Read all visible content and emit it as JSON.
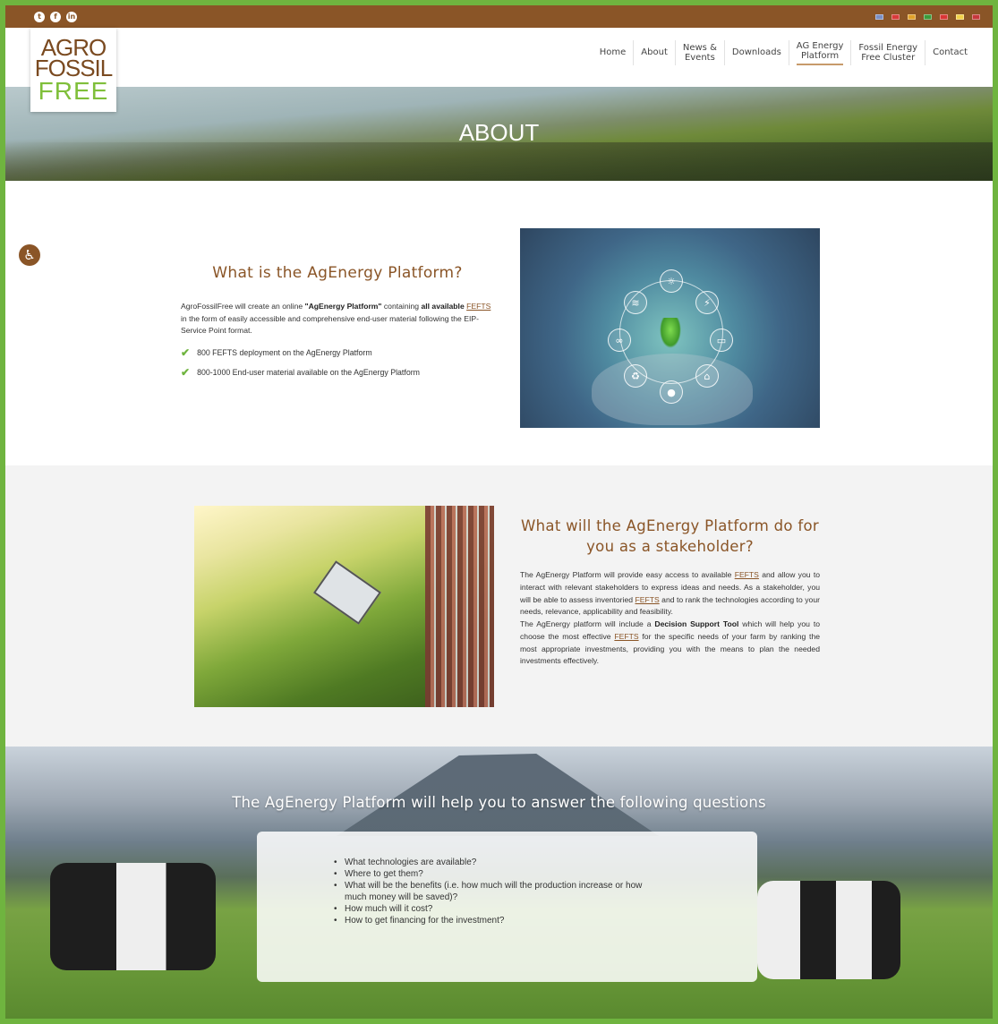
{
  "social": [
    "t",
    "f",
    "in"
  ],
  "language_flags": [
    "#7b8fc4",
    "#d83a3a",
    "#e0a12a",
    "#3b9b3b",
    "#d93535",
    "#f2d14a",
    "#c7373d"
  ],
  "logo": {
    "line1": "AGRO",
    "line2": "FOSSIL",
    "line3": "FREE"
  },
  "nav": [
    {
      "label": "Home"
    },
    {
      "label": "About"
    },
    {
      "label": "News &\nEvents"
    },
    {
      "label": "Downloads"
    },
    {
      "label": "AG Energy\nPlatform"
    },
    {
      "label": "Fossil Energy\nFree Cluster"
    },
    {
      "label": "Contact"
    }
  ],
  "hero": {
    "title": "ABOUT"
  },
  "section1": {
    "heading": "What is the AgEnergy Platform?",
    "para_pre": "AgroFossilFree will create an online ",
    "para_bold1": "\"AgEnergy Platform\"",
    "para_mid": " containing ",
    "para_bold2": "all available",
    "para_link": "FEFTS",
    "para_post": " in the form of easily accessible and comprehensive end-user material following the EIP-Service Point format.",
    "checks": [
      "800  FEFTS deployment on the AgEnergy Platform",
      "800-1000  End-user material available on the AgEnergy Platform"
    ]
  },
  "section2": {
    "heading": "What will the AgEnergy Platform do for you as a stakeholder?",
    "p1_a": "The AgEnergy Platform will provide easy access to available ",
    "p1_link1": "FEFTS",
    "p1_b": " and allow you to interact with relevant stakeholders to express ideas and needs. As a stakeholder, you will be able to assess inventoried ",
    "p1_link2": "FEFTS",
    "p1_c": " and to rank the technologies according to your needs, relevance, applicability and feasibility.",
    "p2_a": "The AgEnergy platform will include a ",
    "p2_bold": "Decision Support Tool",
    "p2_b": " which will help you to choose the most effective ",
    "p2_link": "FEFTS",
    "p2_c": " for the specific needs of your farm by ranking the most appropriate investments, providing you with the means to plan the needed investments effectively."
  },
  "section3": {
    "title": "The AgEnergy Platform will help you to answer the following questions",
    "questions": [
      "What technologies are available?",
      "Where to get them?",
      "What will be the benefits (i.e. how much will the production increase or how much money will be saved)?",
      "How much will it cost?",
      "How to get financing for the investment?"
    ]
  },
  "colors": {
    "brand_brown": "#8a5527",
    "brand_green": "#6fb43f"
  }
}
